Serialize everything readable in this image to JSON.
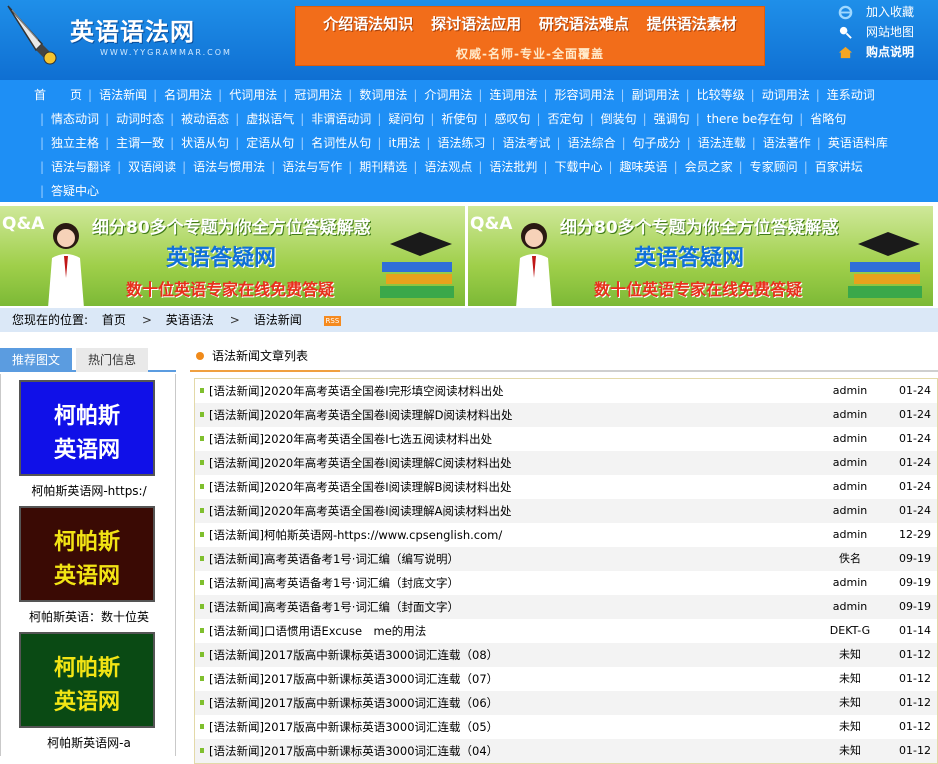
{
  "header": {
    "site_title": "英语语法网",
    "site_url": "WWW.YYGRAMMAR.COM",
    "banner": {
      "items": [
        "介绍语法知识",
        "探讨语法应用",
        "研究语法难点",
        "提供语法素材"
      ],
      "tagline": "权威-名师-专业-全面覆盖"
    },
    "top_links": [
      {
        "label": "加入收藏",
        "icon": "ie-icon"
      },
      {
        "label": "网站地图",
        "icon": "map-icon"
      },
      {
        "label": "购点说明",
        "icon": "home-icon"
      }
    ]
  },
  "nav": [
    "首　　页",
    "语法新闻",
    "名词用法",
    "代词用法",
    "冠词用法",
    "数词用法",
    "介词用法",
    "连词用法",
    "形容词用法",
    "副词用法",
    "比较等级",
    "动词用法",
    "连系动词",
    "情态动词",
    "动词时态",
    "被动语态",
    "虚拟语气",
    "非谓语动词",
    "疑问句",
    "祈使句",
    "感叹句",
    "否定句",
    "倒装句",
    "强调句",
    "there be存在句",
    "省略句",
    "独立主格",
    "主谓一致",
    "状语从句",
    "定语从句",
    "名词性从句",
    "it用法",
    "语法练习",
    "语法考试",
    "语法综合",
    "句子成分",
    "语法连载",
    "语法著作",
    "英语语料库",
    "语法与翻译",
    "双语阅读",
    "语法与惯用法",
    "语法与写作",
    "期刊精选",
    "语法观点",
    "语法批判",
    "下载中心",
    "趣味英语",
    "会员之家",
    "专家顾问",
    "百家讲坛",
    "答疑中心"
  ],
  "ads": [
    {
      "qa": "Q&A",
      "line1": "细分80多个专题为你全方位答疑解惑",
      "line2": "英语答疑网",
      "line3": "数十位英语专家在线免费答疑"
    },
    {
      "qa": "Q&A",
      "line1": "细分80多个专题为你全方位答疑解惑",
      "line2": "英语答疑网",
      "line3": "数十位英语专家在线免费答疑"
    }
  ],
  "breadcrumb": {
    "label": "您现在的位置:",
    "items": [
      "首页",
      "英语语法",
      "语法新闻"
    ],
    "rss": "RSS"
  },
  "sidebar": {
    "tabs": [
      "推荐图文",
      "热门信息"
    ],
    "pics": [
      {
        "text1": "柯帕斯",
        "text2": "英语网",
        "caption": "柯帕斯英语网-https:/",
        "bg": "#1010e8",
        "fg": "#ffffff"
      },
      {
        "text1": "柯帕斯",
        "text2": "英语网",
        "caption": "柯帕斯英语：数十位英",
        "bg": "#3a0a04",
        "fg": "#f2e414"
      },
      {
        "text1": "柯帕斯",
        "text2": "英语网",
        "caption": "柯帕斯英语网-a",
        "bg": "#0a4a14",
        "fg": "#f2e414"
      }
    ]
  },
  "main": {
    "heading": "语法新闻文章列表",
    "articles": [
      {
        "title": "[语法新闻]2020年高考英语全国卷Ⅰ完形填空阅读材料出处",
        "author": "admin",
        "date": "01-24"
      },
      {
        "title": "[语法新闻]2020年高考英语全国卷Ⅰ阅读理解D阅读材料出处",
        "author": "admin",
        "date": "01-24"
      },
      {
        "title": "[语法新闻]2020年高考英语全国卷Ⅰ七选五阅读材料出处",
        "author": "admin",
        "date": "01-24"
      },
      {
        "title": "[语法新闻]2020年高考英语全国卷Ⅰ阅读理解C阅读材料出处",
        "author": "admin",
        "date": "01-24"
      },
      {
        "title": "[语法新闻]2020年高考英语全国卷Ⅰ阅读理解B阅读材料出处",
        "author": "admin",
        "date": "01-24"
      },
      {
        "title": "[语法新闻]2020年高考英语全国卷Ⅰ阅读理解A阅读材料出处",
        "author": "admin",
        "date": "01-24"
      },
      {
        "title": "[语法新闻]柯帕斯英语网-https://www.cpsenglish.com/",
        "author": "admin",
        "date": "12-29"
      },
      {
        "title": "[语法新闻]高考英语备考1号·词汇编（编写说明）",
        "author": "佚名",
        "date": "09-19"
      },
      {
        "title": "[语法新闻]高考英语备考1号·词汇编（封底文字）",
        "author": "admin",
        "date": "09-19"
      },
      {
        "title": "[语法新闻]高考英语备考1号·词汇编（封面文字）",
        "author": "admin",
        "date": "09-19"
      },
      {
        "title": "[语法新闻]口语惯用语Excuse　me的用法",
        "author": "DEKT-G",
        "date": "01-14"
      },
      {
        "title": "[语法新闻]2017版高中新课标英语3000词汇连载（08）",
        "author": "未知",
        "date": "01-12"
      },
      {
        "title": "[语法新闻]2017版高中新课标英语3000词汇连载（07）",
        "author": "未知",
        "date": "01-12"
      },
      {
        "title": "[语法新闻]2017版高中新课标英语3000词汇连载（06）",
        "author": "未知",
        "date": "01-12"
      },
      {
        "title": "[语法新闻]2017版高中新课标英语3000词汇连载（05）",
        "author": "未知",
        "date": "01-12"
      },
      {
        "title": "[语法新闻]2017版高中新课标英语3000词汇连载（04）",
        "author": "未知",
        "date": "01-12"
      }
    ]
  }
}
